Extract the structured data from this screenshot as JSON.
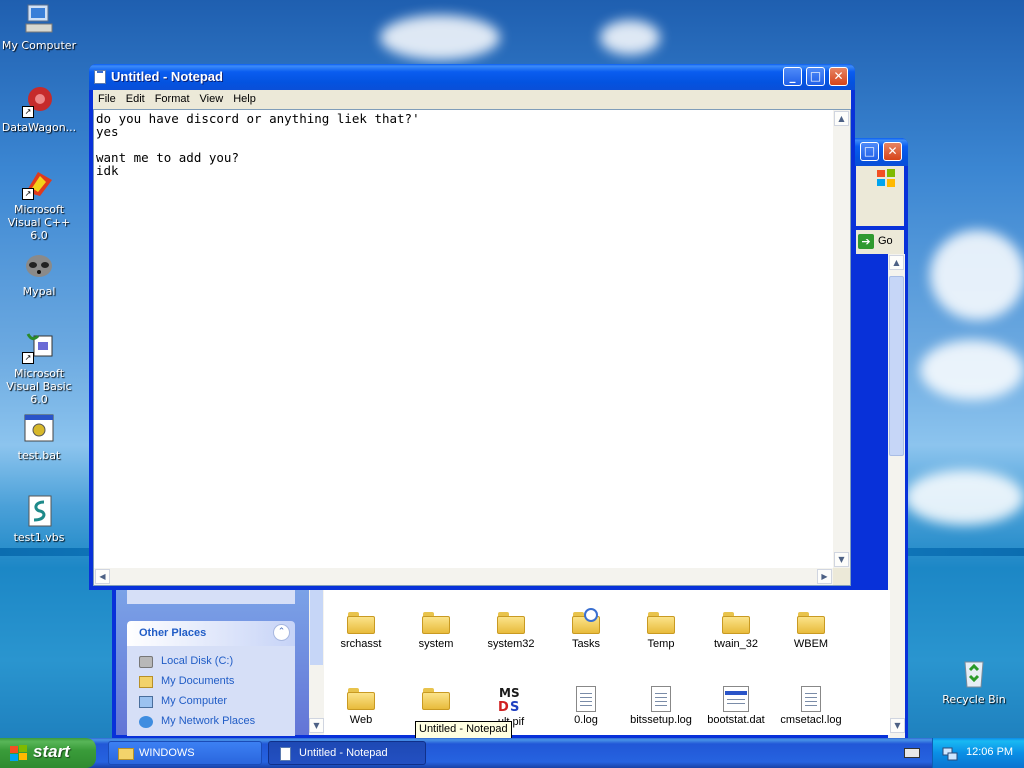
{
  "desktop": {
    "icons": [
      {
        "label": "My Computer"
      },
      {
        "label": "DataWagon..."
      },
      {
        "label": "Microsoft Visual C++ 6.0"
      },
      {
        "label": "Mypal"
      },
      {
        "label": "Microsoft Visual Basic 6.0"
      },
      {
        "label": "test.bat"
      },
      {
        "label": "test1.vbs"
      },
      {
        "label": "Recycle Bin"
      }
    ]
  },
  "notepad": {
    "title": "Untitled - Notepad",
    "menu": [
      "File",
      "Edit",
      "Format",
      "View",
      "Help"
    ],
    "content": "do you have discord or anything liek that?'\nyes\n\nwant me to add you?\nidk"
  },
  "explorer": {
    "go_label": "Go",
    "other_places": {
      "title": "Other Places",
      "links": [
        "Local Disk (C:)",
        "My Documents",
        "My Computer",
        "My Network Places"
      ]
    },
    "files_row1": [
      "srchasst",
      "system",
      "system32",
      "Tasks",
      "Temp",
      "twain_32",
      "WBEM"
    ],
    "files_row2": [
      "Web",
      "",
      "ult.pif",
      "0.log",
      "bitssetup.log",
      "bootstat.dat",
      "cmsetacl.log"
    ]
  },
  "tooltip": "Untitled - Notepad",
  "taskbar": {
    "start_label": "start",
    "buttons": [
      "WINDOWS",
      "Untitled - Notepad"
    ],
    "clock": "12:06 PM"
  },
  "colors": {
    "titlebar": "#0a5df0",
    "start": "#3a9c3a",
    "taskbar": "#2157d7"
  }
}
